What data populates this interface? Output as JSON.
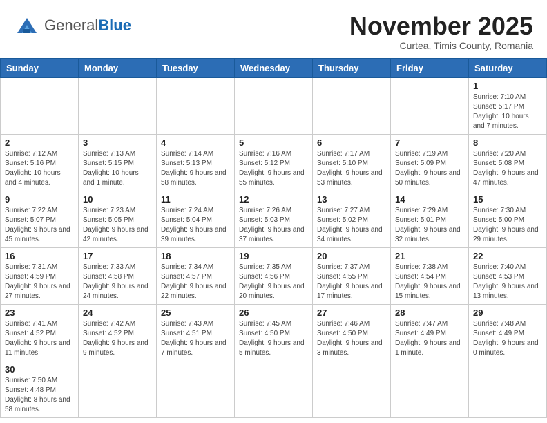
{
  "header": {
    "logo_general": "General",
    "logo_blue": "Blue",
    "month_title": "November 2025",
    "subtitle": "Curtea, Timis County, Romania"
  },
  "days_of_week": [
    "Sunday",
    "Monday",
    "Tuesday",
    "Wednesday",
    "Thursday",
    "Friday",
    "Saturday"
  ],
  "weeks": [
    [
      {
        "day": "",
        "info": ""
      },
      {
        "day": "",
        "info": ""
      },
      {
        "day": "",
        "info": ""
      },
      {
        "day": "",
        "info": ""
      },
      {
        "day": "",
        "info": ""
      },
      {
        "day": "",
        "info": ""
      },
      {
        "day": "1",
        "info": "Sunrise: 7:10 AM\nSunset: 5:17 PM\nDaylight: 10 hours and 7 minutes."
      }
    ],
    [
      {
        "day": "2",
        "info": "Sunrise: 7:12 AM\nSunset: 5:16 PM\nDaylight: 10 hours and 4 minutes."
      },
      {
        "day": "3",
        "info": "Sunrise: 7:13 AM\nSunset: 5:15 PM\nDaylight: 10 hours and 1 minute."
      },
      {
        "day": "4",
        "info": "Sunrise: 7:14 AM\nSunset: 5:13 PM\nDaylight: 9 hours and 58 minutes."
      },
      {
        "day": "5",
        "info": "Sunrise: 7:16 AM\nSunset: 5:12 PM\nDaylight: 9 hours and 55 minutes."
      },
      {
        "day": "6",
        "info": "Sunrise: 7:17 AM\nSunset: 5:10 PM\nDaylight: 9 hours and 53 minutes."
      },
      {
        "day": "7",
        "info": "Sunrise: 7:19 AM\nSunset: 5:09 PM\nDaylight: 9 hours and 50 minutes."
      },
      {
        "day": "8",
        "info": "Sunrise: 7:20 AM\nSunset: 5:08 PM\nDaylight: 9 hours and 47 minutes."
      }
    ],
    [
      {
        "day": "9",
        "info": "Sunrise: 7:22 AM\nSunset: 5:07 PM\nDaylight: 9 hours and 45 minutes."
      },
      {
        "day": "10",
        "info": "Sunrise: 7:23 AM\nSunset: 5:05 PM\nDaylight: 9 hours and 42 minutes."
      },
      {
        "day": "11",
        "info": "Sunrise: 7:24 AM\nSunset: 5:04 PM\nDaylight: 9 hours and 39 minutes."
      },
      {
        "day": "12",
        "info": "Sunrise: 7:26 AM\nSunset: 5:03 PM\nDaylight: 9 hours and 37 minutes."
      },
      {
        "day": "13",
        "info": "Sunrise: 7:27 AM\nSunset: 5:02 PM\nDaylight: 9 hours and 34 minutes."
      },
      {
        "day": "14",
        "info": "Sunrise: 7:29 AM\nSunset: 5:01 PM\nDaylight: 9 hours and 32 minutes."
      },
      {
        "day": "15",
        "info": "Sunrise: 7:30 AM\nSunset: 5:00 PM\nDaylight: 9 hours and 29 minutes."
      }
    ],
    [
      {
        "day": "16",
        "info": "Sunrise: 7:31 AM\nSunset: 4:59 PM\nDaylight: 9 hours and 27 minutes."
      },
      {
        "day": "17",
        "info": "Sunrise: 7:33 AM\nSunset: 4:58 PM\nDaylight: 9 hours and 24 minutes."
      },
      {
        "day": "18",
        "info": "Sunrise: 7:34 AM\nSunset: 4:57 PM\nDaylight: 9 hours and 22 minutes."
      },
      {
        "day": "19",
        "info": "Sunrise: 7:35 AM\nSunset: 4:56 PM\nDaylight: 9 hours and 20 minutes."
      },
      {
        "day": "20",
        "info": "Sunrise: 7:37 AM\nSunset: 4:55 PM\nDaylight: 9 hours and 17 minutes."
      },
      {
        "day": "21",
        "info": "Sunrise: 7:38 AM\nSunset: 4:54 PM\nDaylight: 9 hours and 15 minutes."
      },
      {
        "day": "22",
        "info": "Sunrise: 7:40 AM\nSunset: 4:53 PM\nDaylight: 9 hours and 13 minutes."
      }
    ],
    [
      {
        "day": "23",
        "info": "Sunrise: 7:41 AM\nSunset: 4:52 PM\nDaylight: 9 hours and 11 minutes."
      },
      {
        "day": "24",
        "info": "Sunrise: 7:42 AM\nSunset: 4:52 PM\nDaylight: 9 hours and 9 minutes."
      },
      {
        "day": "25",
        "info": "Sunrise: 7:43 AM\nSunset: 4:51 PM\nDaylight: 9 hours and 7 minutes."
      },
      {
        "day": "26",
        "info": "Sunrise: 7:45 AM\nSunset: 4:50 PM\nDaylight: 9 hours and 5 minutes."
      },
      {
        "day": "27",
        "info": "Sunrise: 7:46 AM\nSunset: 4:50 PM\nDaylight: 9 hours and 3 minutes."
      },
      {
        "day": "28",
        "info": "Sunrise: 7:47 AM\nSunset: 4:49 PM\nDaylight: 9 hours and 1 minute."
      },
      {
        "day": "29",
        "info": "Sunrise: 7:48 AM\nSunset: 4:49 PM\nDaylight: 9 hours and 0 minutes."
      }
    ],
    [
      {
        "day": "30",
        "info": "Sunrise: 7:50 AM\nSunset: 4:48 PM\nDaylight: 8 hours and 58 minutes."
      },
      {
        "day": "",
        "info": ""
      },
      {
        "day": "",
        "info": ""
      },
      {
        "day": "",
        "info": ""
      },
      {
        "day": "",
        "info": ""
      },
      {
        "day": "",
        "info": ""
      },
      {
        "day": "",
        "info": ""
      }
    ]
  ]
}
